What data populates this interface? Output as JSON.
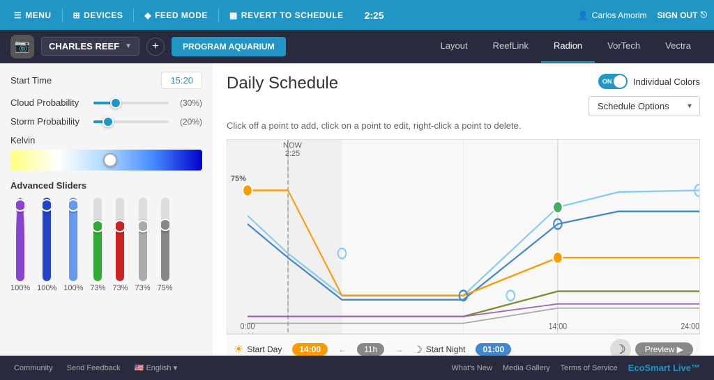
{
  "topnav": {
    "menu": "MENU",
    "devices": "DEVICES",
    "feed_mode": "FEED MODE",
    "revert": "REVERT TO SCHEDULE",
    "time": "2:25",
    "user": "Carlos Amorim",
    "signout": "SIGN OUT"
  },
  "secondrow": {
    "tank_name": "CHARLES REEF",
    "program_btn": "PROGRAM AQUARIUM",
    "tabs": [
      "Layout",
      "ReefLink",
      "Radion",
      "VorTech",
      "Vectra"
    ]
  },
  "left_panel": {
    "start_time_label": "Start Time",
    "start_time_value": "15:20",
    "cloud_label": "Cloud Probability",
    "cloud_pct": "(30%)",
    "storm_label": "Storm Probability",
    "storm_pct": "(20%)",
    "kelvin_label": "Kelvin",
    "adv_label": "Advanced Sliders",
    "sliders": [
      {
        "color": "#8844cc",
        "pct": "100%"
      },
      {
        "color": "#2244cc",
        "pct": "100%"
      },
      {
        "color": "#6699ee",
        "pct": "100%"
      },
      {
        "color": "#33aa33",
        "pct": "73%"
      },
      {
        "color": "#cc2222",
        "pct": "73%"
      },
      {
        "color": "#aaaaaa",
        "pct": "73%"
      },
      {
        "color": "#888888",
        "pct": "75%"
      }
    ]
  },
  "main": {
    "title": "Daily Schedule",
    "instruction": "Click off a point to add, click on a point to edit, right-click a point to delete.",
    "toggle_label": "Individual Colors",
    "toggle_state": "ON",
    "schedule_options": "Schedule Options",
    "chart": {
      "now_label": "NOW",
      "now_time": "2:25",
      "pct_label": "75%",
      "time_start": "0:00",
      "time_mid": "14:00",
      "time_end": "24:00"
    }
  },
  "schedule_bottom": {
    "start_day": "Start Day",
    "start_time": "14:00",
    "duration": "11h",
    "start_night": "Start Night",
    "night_time": "01:00",
    "preview": "Preview ▶"
  },
  "footer": {
    "community": "Community",
    "feedback": "Send Feedback",
    "language": "English",
    "whats_new": "What's New",
    "gallery": "Media Gallery",
    "terms": "Terms of Service",
    "logo": "EcoSmart Live™"
  }
}
